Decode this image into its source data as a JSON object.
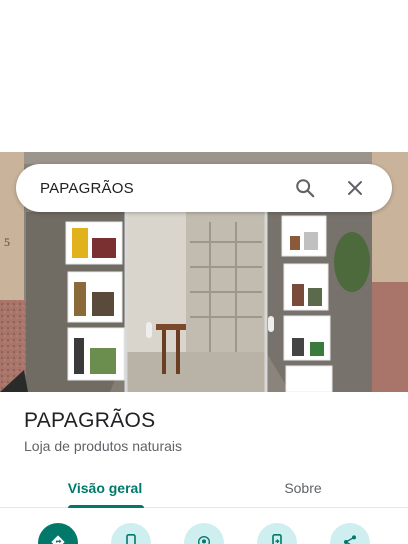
{
  "search": {
    "query": "PAPAGRÃOS",
    "search_icon": "search-icon",
    "clear_icon": "close-icon"
  },
  "place": {
    "name": "PAPAGRÃOS",
    "category": "Loja de produtos naturais"
  },
  "tabs": [
    {
      "label": "Visão geral",
      "active": true
    },
    {
      "label": "Sobre",
      "active": false
    }
  ],
  "actions": [
    {
      "icon": "directions-icon",
      "style": "primary"
    },
    {
      "icon": "phone-icon",
      "style": "secondary"
    },
    {
      "icon": "nearby-icon",
      "style": "secondary"
    },
    {
      "icon": "send-to-phone-icon",
      "style": "secondary"
    },
    {
      "icon": "share-icon",
      "style": "secondary"
    }
  ],
  "colors": {
    "accent": "#00796b",
    "action_bg": "#cfeef0",
    "text_primary": "#202124",
    "text_secondary": "#5f6368"
  }
}
